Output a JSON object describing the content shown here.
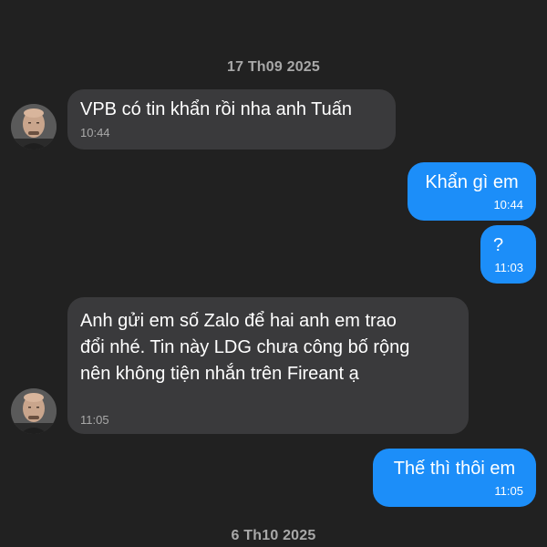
{
  "colors": {
    "background": "#212121",
    "incoming_bubble": "#3a3a3c",
    "outgoing_bubble": "#1c8ef9",
    "date_separator": "#a8a8a8"
  },
  "date_separators": [
    "17 Th09 2025",
    "6 Th10 2025"
  ],
  "messages": [
    {
      "direction": "incoming",
      "text": "VPB có tin khẩn rồi nha anh Tuấn",
      "time": "10:44",
      "avatar": "contact-avatar"
    },
    {
      "direction": "outgoing",
      "text": "Khẩn gì em",
      "time": "10:44"
    },
    {
      "direction": "outgoing",
      "text": "?",
      "time": "11:03"
    },
    {
      "direction": "incoming",
      "text": "Anh gửi em số Zalo để hai anh em trao\nđổi nhé. Tin này LDG chưa công bố rộng\nnên không tiện nhắn trên Fireant ạ",
      "time": "11:05",
      "avatar": "contact-avatar"
    },
    {
      "direction": "outgoing",
      "text": "Thế thì thôi em",
      "time": "11:05"
    }
  ]
}
